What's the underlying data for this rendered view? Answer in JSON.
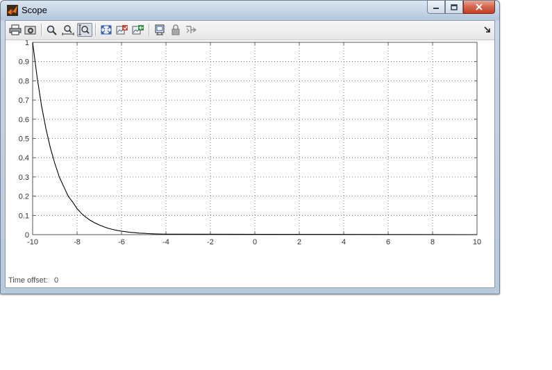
{
  "window": {
    "title": "Scope",
    "title_icon": "matlab-logo",
    "buttons": [
      "minimize",
      "maximize",
      "close"
    ]
  },
  "toolbar": {
    "items": [
      {
        "name": "print-icon",
        "tooltip": "Print"
      },
      {
        "name": "parameters-icon",
        "tooltip": "Parameters"
      },
      {
        "name": "zoom-icon",
        "tooltip": "Zoom"
      },
      {
        "name": "zoom-x-icon",
        "tooltip": "Zoom X-axis"
      },
      {
        "name": "zoom-y-icon",
        "tooltip": "Zoom Y-axis",
        "pressed": true
      },
      {
        "name": "autoscale-icon",
        "tooltip": "Autoscale"
      },
      {
        "name": "save-axes-icon",
        "tooltip": "Save current axes settings"
      },
      {
        "name": "restore-axes-icon",
        "tooltip": "Restore saved axes settings"
      },
      {
        "name": "floating-scope-icon",
        "tooltip": "Floating scope"
      },
      {
        "name": "lock-icon",
        "tooltip": "Lock/Unlock axes selection"
      },
      {
        "name": "signal-selection-icon",
        "tooltip": "Signal selection"
      }
    ]
  },
  "status": {
    "time_offset_label": "Time offset:",
    "time_offset_value": "0"
  },
  "colors": {
    "trace": "#000000",
    "grid": "#555555",
    "tick_text": "#333333"
  },
  "chart_data": {
    "type": "line",
    "title": "",
    "xlabel": "",
    "ylabel": "",
    "xlim": [
      -10,
      10
    ],
    "ylim": [
      0,
      1
    ],
    "grid": true,
    "x_ticks": [
      -10,
      -8,
      -6,
      -4,
      -2,
      0,
      2,
      4,
      6,
      8,
      10
    ],
    "y_ticks": [
      0,
      0.1,
      0.2,
      0.3,
      0.4,
      0.5,
      0.6,
      0.7,
      0.8,
      0.9,
      1
    ],
    "series": [
      {
        "x": [
          -10,
          -9.8,
          -9.6,
          -9.4,
          -9.2,
          -9.0,
          -8.8,
          -8.6,
          -8.4,
          -8.2,
          -8.0,
          -7.8,
          -7.6,
          -7.4,
          -7.2,
          -7.0,
          -6.8,
          -6.6,
          -6.4,
          -6.2,
          -6.0,
          -5.8,
          -5.6,
          -5.4,
          -5.2,
          -5.0,
          -4.8,
          -4.6,
          -4.4,
          -4.2,
          -4.0,
          10
        ],
        "values": [
          1.0,
          0.82,
          0.67,
          0.55,
          0.45,
          0.37,
          0.3,
          0.25,
          0.2,
          0.17,
          0.135,
          0.11,
          0.09,
          0.074,
          0.061,
          0.05,
          0.041,
          0.033,
          0.027,
          0.022,
          0.018,
          0.015,
          0.012,
          0.01,
          0.008,
          0.0067,
          0.0055,
          0.0045,
          0.0037,
          0.003,
          0.0025,
          0.0
        ]
      }
    ]
  }
}
